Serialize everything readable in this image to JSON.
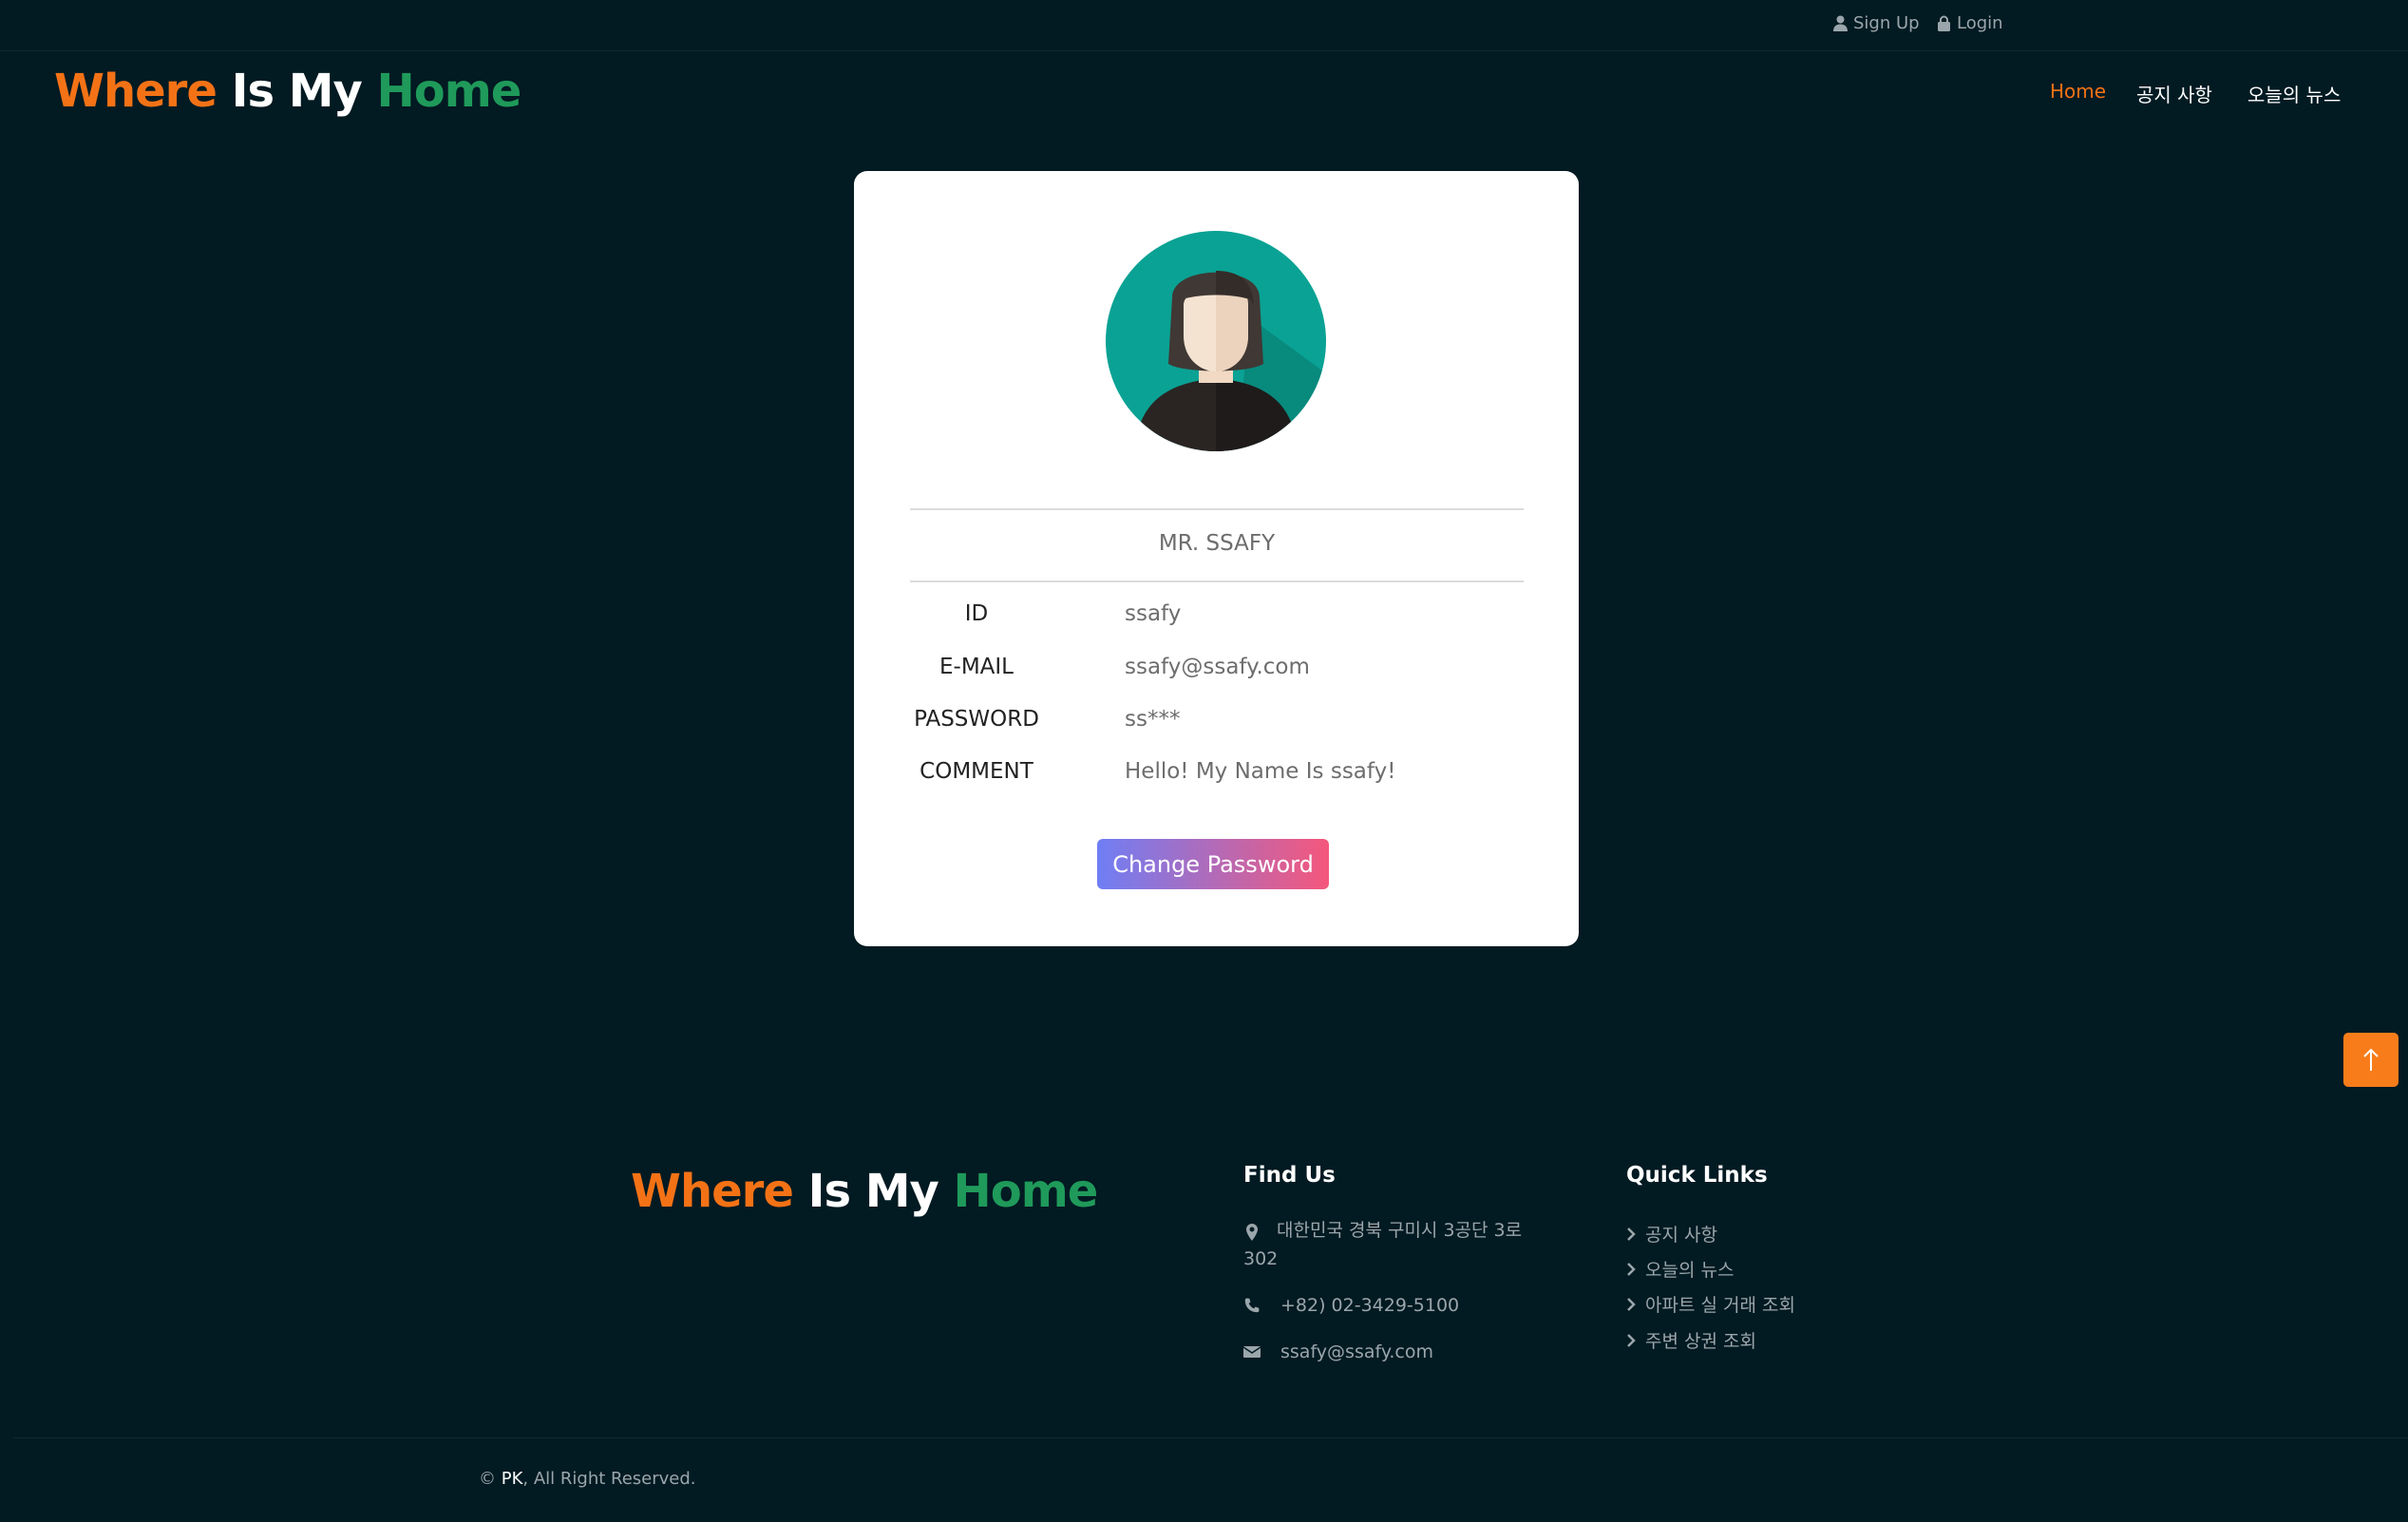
{
  "topbar": {
    "signup_label": "Sign Up",
    "login_label": "Login"
  },
  "logo": {
    "word1": "Where",
    "word2": "Is My",
    "word3": "Home"
  },
  "nav": {
    "items": [
      {
        "label": "Home"
      },
      {
        "label": "공지 사항"
      },
      {
        "label": "오늘의 뉴스"
      }
    ]
  },
  "profile": {
    "name": "MR. SSAFY",
    "fields": [
      {
        "label": "ID",
        "value": "ssafy"
      },
      {
        "label": "E-MAIL",
        "value": "ssafy@ssafy.com"
      },
      {
        "label": "PASSWORD",
        "value": "ss***"
      },
      {
        "label": "COMMENT",
        "value": "Hello! My Name Is ssafy!"
      }
    ],
    "button_label": "Change Password"
  },
  "footer": {
    "find_us_title": "Find Us",
    "address": "대한민국 경북 구미시 3공단 3로 302",
    "phone": "+82) 02-3429-5100",
    "email": "ssafy@ssafy.com",
    "quick_links_title": "Quick Links",
    "quick_links": [
      "공지 사항",
      "오늘의 뉴스",
      "아파트 실 거래 조회",
      "주변 상권 조회"
    ],
    "copyright_prefix": "© ",
    "copyright_owner": "PK",
    "copyright_suffix": ", All Right Reserved."
  },
  "colors": {
    "background": "#021a22",
    "accent_orange": "#f47216",
    "logo_green": "#1f9a5a"
  }
}
